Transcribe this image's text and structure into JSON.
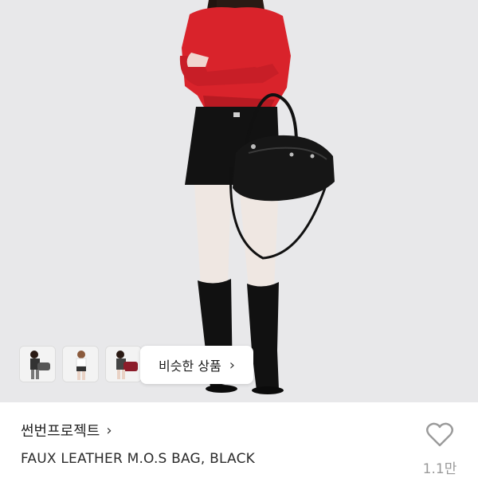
{
  "similar_button": {
    "label": "비슷한 상품",
    "chevron": "›"
  },
  "seller": {
    "name": "썬번프로젝트",
    "chevron": "›"
  },
  "product": {
    "title": "FAUX LEATHER M.O.S BAG, BLACK"
  },
  "like": {
    "count": "1.1만",
    "icon": "heart-outline-icon"
  },
  "thumbnails": [
    {
      "icon": "thumbnail-model-with-black-bag"
    },
    {
      "icon": "thumbnail-model-white-top"
    },
    {
      "icon": "thumbnail-model-with-red-bag"
    }
  ],
  "colors": {
    "background": "#e8e8ea",
    "top": "#d9232b",
    "bag": "#161616",
    "muted_text": "#999999"
  }
}
